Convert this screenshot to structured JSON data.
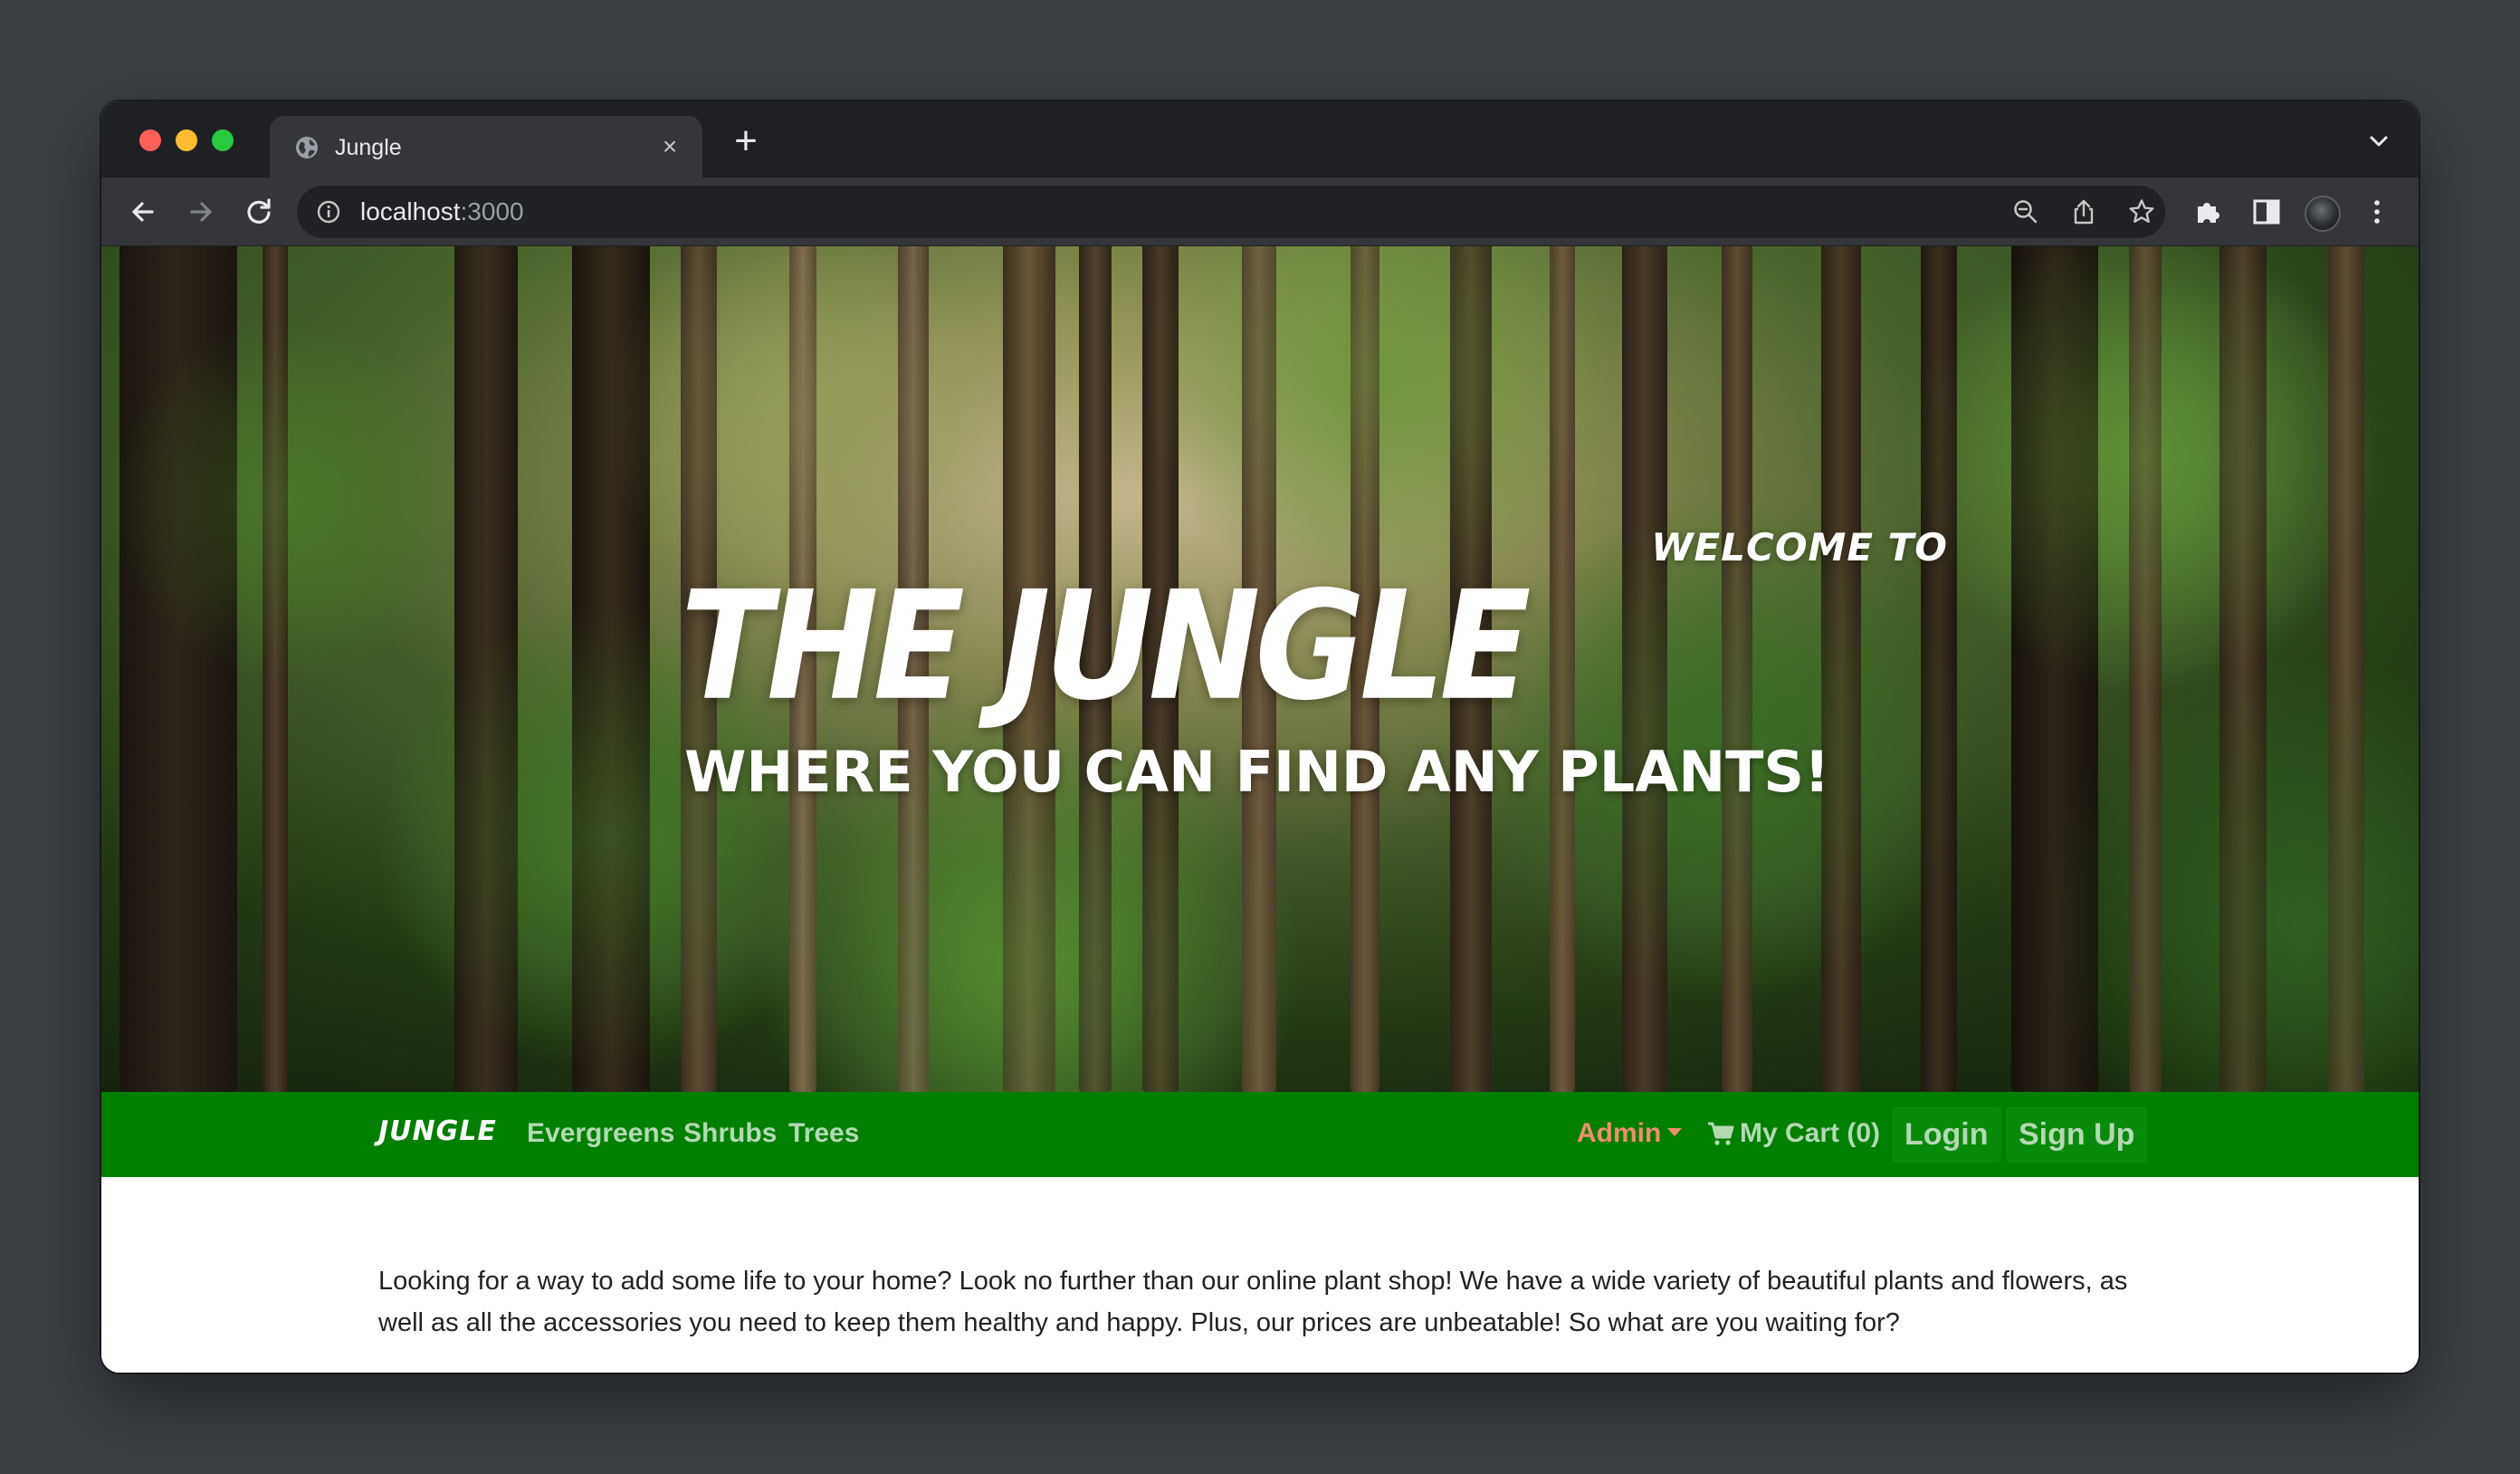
{
  "browser": {
    "tab_title": "Jungle",
    "new_tab": "+",
    "close": "×",
    "url_host": "localhost",
    "url_port": ":3000"
  },
  "hero": {
    "welcome": "WELCOME TO",
    "title": "THE JUNGLE",
    "subtitle": "WHERE YOU CAN FIND ANY PLANTS!"
  },
  "nav": {
    "brand": "JUNGLE",
    "links": [
      "Evergreens",
      "Shrubs",
      "Trees"
    ],
    "admin": "Admin",
    "cart": "My Cart (0)",
    "login": "Login",
    "signup": "Sign Up"
  },
  "content": {
    "paragraph": "Looking for a way to add some life to your home? Look no further than our online plant shop! We have a wide variety of beautiful plants and flowers, as well as all the accessories you need to keep them healthy and happy. Plus, our prices are unbeatable! So what are you waiting for?"
  },
  "colors": {
    "nav_bg": "#007f00",
    "nav_link": "#b3d9b3",
    "admin": "#f28c6e",
    "browser_dark": "#35363a"
  }
}
